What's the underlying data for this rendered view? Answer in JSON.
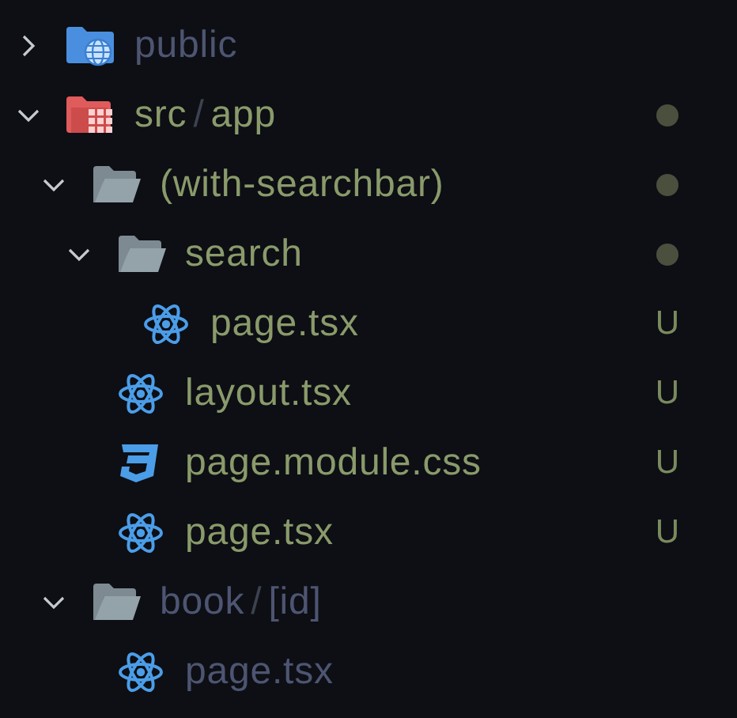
{
  "separator": "/",
  "tree": [
    {
      "segments": [
        "public"
      ],
      "kind": "folder-globe",
      "expanded": false,
      "dimmed": true
    },
    {
      "segments": [
        "src",
        "app"
      ],
      "kind": "folder-app",
      "expanded": true,
      "dimmed": false,
      "dot": true,
      "children": [
        {
          "segments": [
            "(with-searchbar)"
          ],
          "kind": "folder",
          "expanded": true,
          "dimmed": false,
          "dot": true,
          "children": [
            {
              "segments": [
                "search"
              ],
              "kind": "folder",
              "expanded": true,
              "dimmed": false,
              "dot": true,
              "children": [
                {
                  "segments": [
                    "page.tsx"
                  ],
                  "kind": "react",
                  "dimmed": false,
                  "badge": "U"
                }
              ]
            },
            {
              "segments": [
                "layout.tsx"
              ],
              "kind": "react",
              "dimmed": false,
              "badge": "U"
            },
            {
              "segments": [
                "page.module.css"
              ],
              "kind": "css",
              "dimmed": false,
              "badge": "U"
            },
            {
              "segments": [
                "page.tsx"
              ],
              "kind": "react",
              "dimmed": false,
              "badge": "U"
            }
          ]
        },
        {
          "segments": [
            "book",
            "[id]"
          ],
          "kind": "folder",
          "expanded": true,
          "dimmed": true,
          "children": [
            {
              "segments": [
                "page.tsx"
              ],
              "kind": "react",
              "dimmed": true
            }
          ]
        }
      ]
    }
  ]
}
